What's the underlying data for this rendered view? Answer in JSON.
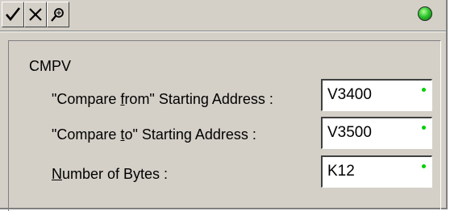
{
  "toolbar": {
    "ok_icon": "check-icon",
    "cancel_icon": "x-icon",
    "search_icon": "search-icon",
    "status_color": "#2ec72e"
  },
  "instruction": "CMPV",
  "fields": {
    "from": {
      "label_pre": "\"Compare ",
      "label_mnemonic": "f",
      "label_post": "rom\" Starting Address :",
      "value": "V3400"
    },
    "to": {
      "label_pre": "\"Compare ",
      "label_mnemonic": "t",
      "label_post": "o\" Starting Address :",
      "value": "V3500"
    },
    "bytes": {
      "label_pre": "",
      "label_mnemonic": "N",
      "label_post": "umber of Bytes :",
      "value": "K12"
    }
  }
}
